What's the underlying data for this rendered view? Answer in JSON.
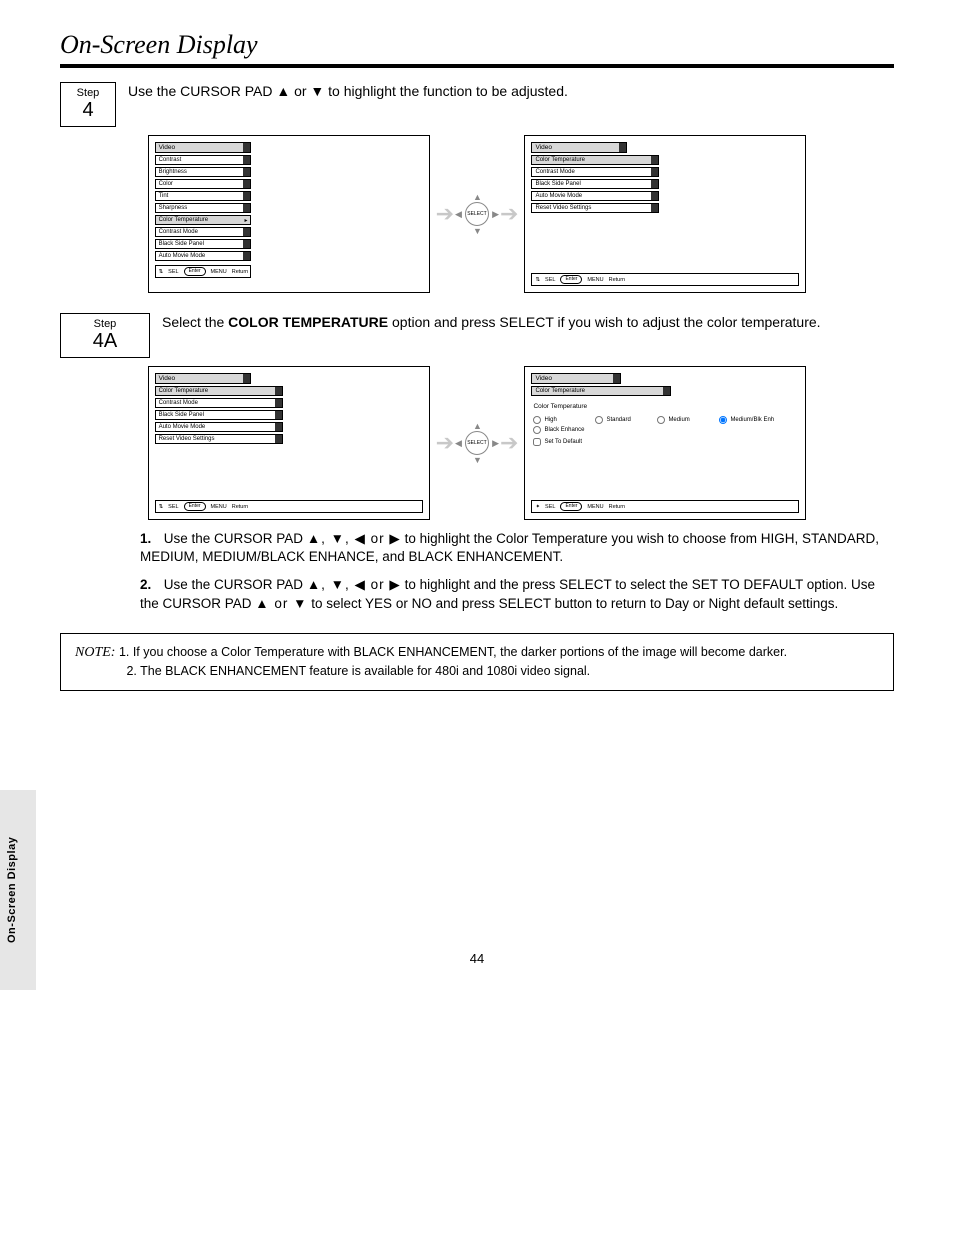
{
  "side_tab": "On-Screen Display",
  "header_title": "On-Screen Display",
  "page_number": "44",
  "step4": {
    "box_label": "Step",
    "box_num": "4",
    "text": "Use the CURSOR PAD ▲ or ▼ to highlight the function to be adjusted."
  },
  "step4a": {
    "box_label": "Step",
    "box_num": "4A",
    "text_before": "Select the ",
    "text_strong": "COLOR TEMPERATURE",
    "text_after": " option and press SELECT if you wish to adjust the color temperature."
  },
  "instr1": {
    "n": "1.",
    "text_before": "Use the CURSOR PAD ",
    "arrows": "▲, ▼, ◀ or ▶",
    "text_after": " to highlight the Color Temperature you wish to choose from HIGH, STANDARD, MEDIUM, MEDIUM/BLACK ENHANCE, and BLACK ENHANCEMENT."
  },
  "instr2": {
    "n": "2.",
    "text_before": "Use the CURSOR PAD ",
    "arrows": "▲, ▼, ◀ or ▶",
    "text_mid": " to highlight and the press SELECT to select the SET TO DEFAULT option. Use the CURSOR PAD ",
    "arrows2": "▲ or ▼",
    "text_after": " to select YES or NO and press SELECT button to return to Day or Night default settings."
  },
  "note": {
    "lead": "NOTE:",
    "l1": "1. If you choose a Color Temperature with BLACK ENHANCEMENT, the darker portions of the image will become darker.",
    "l2": "2. The BLACK ENHANCEMENT feature is available for 480i and 1080i video signal."
  },
  "menu_left_1": {
    "title": "Video",
    "items": [
      {
        "label": "Contrast",
        "hl": false
      },
      {
        "label": "Brightness",
        "hl": false
      },
      {
        "label": "Color",
        "hl": false
      },
      {
        "label": "Tint",
        "hl": false
      },
      {
        "label": "Sharpness",
        "hl": false
      },
      {
        "label": "Color Temperature",
        "hl": true,
        "chev": true
      },
      {
        "label": "Contrast Mode",
        "hl": false
      },
      {
        "label": "Black Side Panel",
        "hl": false
      },
      {
        "label": "Auto Movie Mode",
        "hl": false
      }
    ],
    "footer_sel": "SEL",
    "footer_enter": "Enter",
    "footer_menu": "MENU",
    "footer_return": "Return"
  },
  "menu_right_1": {
    "title": "Video",
    "items": [
      {
        "label": "Color Temperature",
        "hl": true
      },
      {
        "label": "Contrast Mode",
        "hl": false
      },
      {
        "label": "Black Side Panel",
        "hl": false
      },
      {
        "label": "Auto Movie Mode",
        "hl": false
      },
      {
        "label": "Reset Video Settings",
        "hl": false
      }
    ],
    "footer_sel": "SEL",
    "footer_enter": "Enter",
    "footer_menu": "MENU",
    "footer_return": "Return"
  },
  "menu_left_2": {
    "title": "Video",
    "items": [
      {
        "label": "Color Temperature",
        "hl": true
      },
      {
        "label": "Contrast Mode",
        "hl": false
      },
      {
        "label": "Black Side Panel",
        "hl": false
      },
      {
        "label": "Auto Movie Mode",
        "hl": false
      },
      {
        "label": "Reset Video Settings",
        "hl": false
      }
    ],
    "footer_sel": "SEL",
    "footer_enter": "Enter",
    "footer_menu": "MENU",
    "footer_return": "Return"
  },
  "menu_right_2": {
    "title": "Video",
    "sub": "Color Temperature",
    "panel_title": "Color Temperature",
    "opts": [
      "High",
      "Standard",
      "Medium",
      "Medium/Blk Enh",
      "Black Enhance"
    ],
    "default_selected": "Medium/Blk Enh",
    "reset_label": "Set To Default",
    "footer_sel": "SEL",
    "footer_enter": "Enter",
    "footer_menu": "MENU",
    "footer_return": "Return"
  },
  "dpad_label": "SELECT"
}
